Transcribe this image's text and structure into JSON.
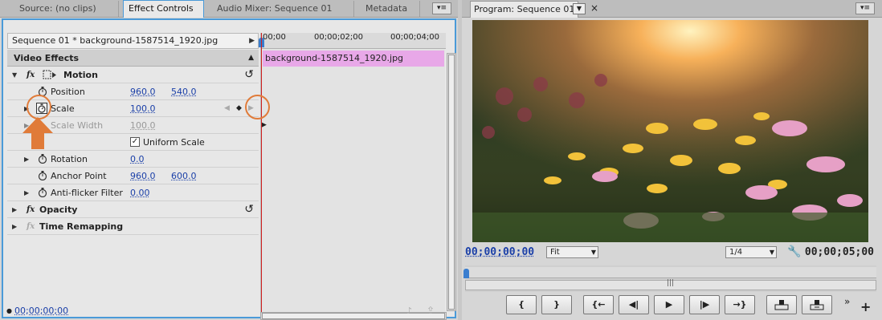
{
  "left_tabs": [
    {
      "label": "Source: (no clips)"
    },
    {
      "label": "Effect Controls"
    },
    {
      "label": "Audio Mixer: Sequence 01"
    },
    {
      "label": "Metadata"
    }
  ],
  "effect_controls": {
    "sequence_clip": "Sequence 01 * background-1587514_1920.jpg",
    "section_title": "Video Effects",
    "clip_name": "background-1587514_1920.jpg",
    "ruler_ticks": [
      "00;00",
      "00;00;02;00",
      "00;00;04;00"
    ],
    "motion": {
      "label": "Motion",
      "position": {
        "label": "Position",
        "x": "960.0",
        "y": "540.0"
      },
      "scale": {
        "label": "Scale",
        "value": "100.0"
      },
      "scale_width": {
        "label": "Scale Width",
        "value": "100.0"
      },
      "uniform_scale": {
        "label": "Uniform Scale",
        "checked": true
      },
      "rotation": {
        "label": "Rotation",
        "value": "0.0"
      },
      "anchor_point": {
        "label": "Anchor Point",
        "x": "960.0",
        "y": "600.0"
      },
      "anti_flicker": {
        "label": "Anti-flicker Filter",
        "value": "0.00"
      }
    },
    "opacity": {
      "label": "Opacity"
    },
    "time_remapping": {
      "label": "Time Remapping"
    },
    "timecode": "00;00;00;00"
  },
  "program_monitor": {
    "tab_label": "Program: Sequence 01",
    "timecode_current": "00;00;00;00",
    "timecode_duration": "00;00;05;00",
    "zoom": "Fit",
    "resolution": "1/4",
    "transport": [
      "{",
      "}",
      "{←",
      "◀|",
      "▶",
      "|▶",
      "→}"
    ]
  },
  "colors": {
    "accent_blue": "#4a9ad8",
    "timecode_blue": "#1a3fa8",
    "clip_pink": "#e8a8e8",
    "annotation_orange": "#e07b39",
    "playhead_red": "#d02020"
  },
  "icons": [
    "fx-icon",
    "motion-icon",
    "stopwatch-icon",
    "reset-icon",
    "panel-menu-icon",
    "close-icon",
    "wrench-icon",
    "lift-icon",
    "extract-icon",
    "plus-icon"
  ]
}
